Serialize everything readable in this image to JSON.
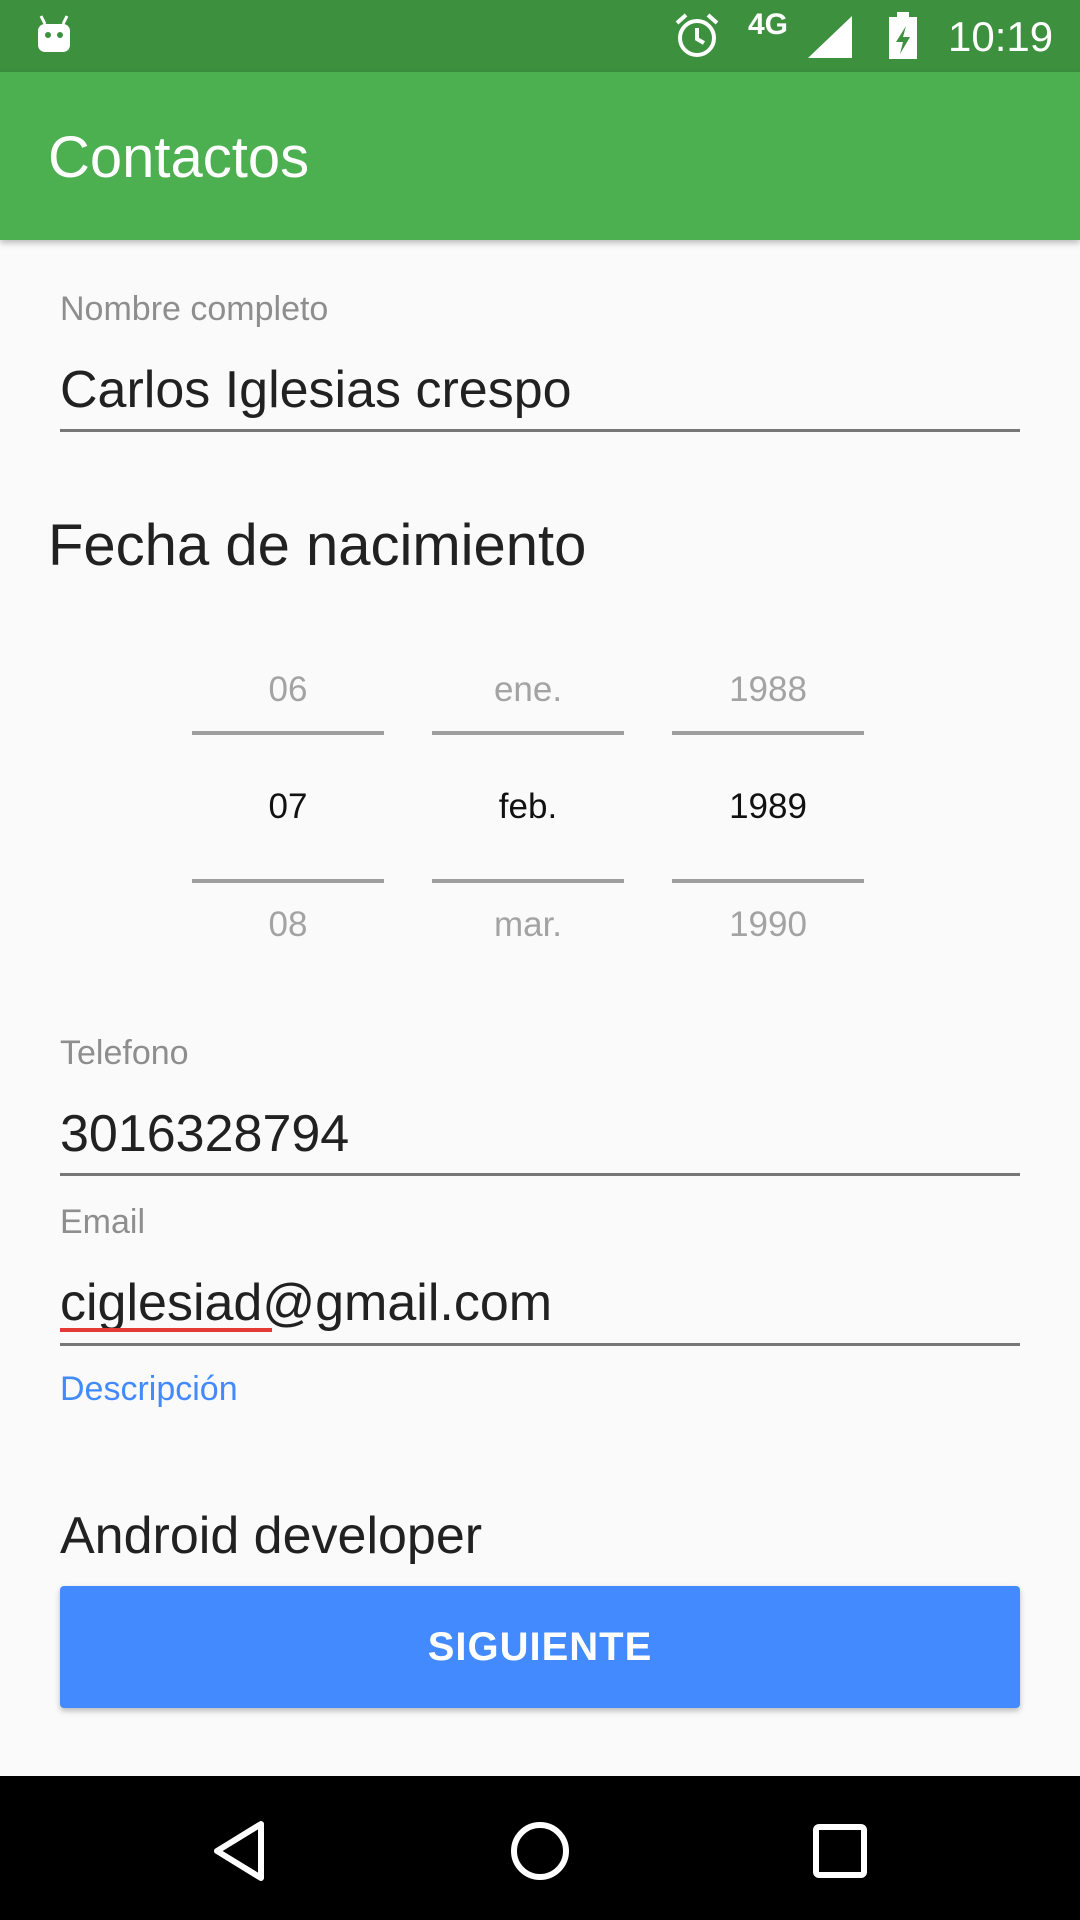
{
  "status_bar": {
    "network": "4G",
    "time": "10:19",
    "icons": [
      "android-icon",
      "alarm-icon",
      "signal-icon",
      "battery-charging-icon"
    ]
  },
  "app_bar": {
    "title": "Contactos",
    "color": "#4caf50"
  },
  "form": {
    "name": {
      "label": "Nombre completo",
      "value": "Carlos Iglesias crespo"
    },
    "birth_date": {
      "title": "Fecha de nacimiento",
      "day": {
        "prev": "06",
        "selected": "07",
        "next": "08"
      },
      "month": {
        "prev": "ene.",
        "selected": "feb.",
        "next": "mar."
      },
      "year": {
        "prev": "1988",
        "selected": "1989",
        "next": "1990"
      }
    },
    "phone": {
      "label": "Telefono",
      "value": "3016328794"
    },
    "email": {
      "label": "Email",
      "value": "ciglesiad@gmail.com"
    },
    "description": {
      "label": "Descripción",
      "value": "Android developer"
    }
  },
  "next_button": {
    "label": "SIGUIENTE",
    "color": "#448aff"
  },
  "nav_bar": {
    "icons": [
      "back-icon",
      "home-icon",
      "recents-icon"
    ]
  }
}
